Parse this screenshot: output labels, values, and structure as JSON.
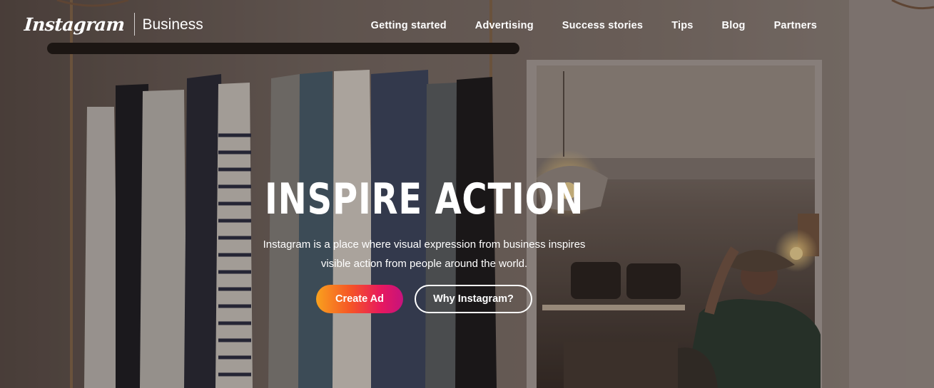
{
  "header": {
    "logo": {
      "wordmark": "Instagram",
      "product": "Business"
    },
    "nav": [
      {
        "label": "Getting started"
      },
      {
        "label": "Advertising"
      },
      {
        "label": "Success stories"
      },
      {
        "label": "Tips"
      },
      {
        "label": "Blog"
      },
      {
        "label": "Partners"
      }
    ]
  },
  "hero": {
    "title": "INSPIRE ACTION",
    "subtitle_line1": "Instagram is a place where visual expression from business inspires",
    "subtitle_line2": "visible action from people around the world.",
    "primary_cta": "Create Ad",
    "secondary_cta": "Why Instagram?"
  },
  "colors": {
    "cta_gradient": [
      "#f9a11d",
      "#f55426",
      "#e7185f",
      "#c6137d"
    ],
    "text": "#ffffff"
  },
  "background": {
    "subject": "clothing-rack-boutique-photo"
  }
}
